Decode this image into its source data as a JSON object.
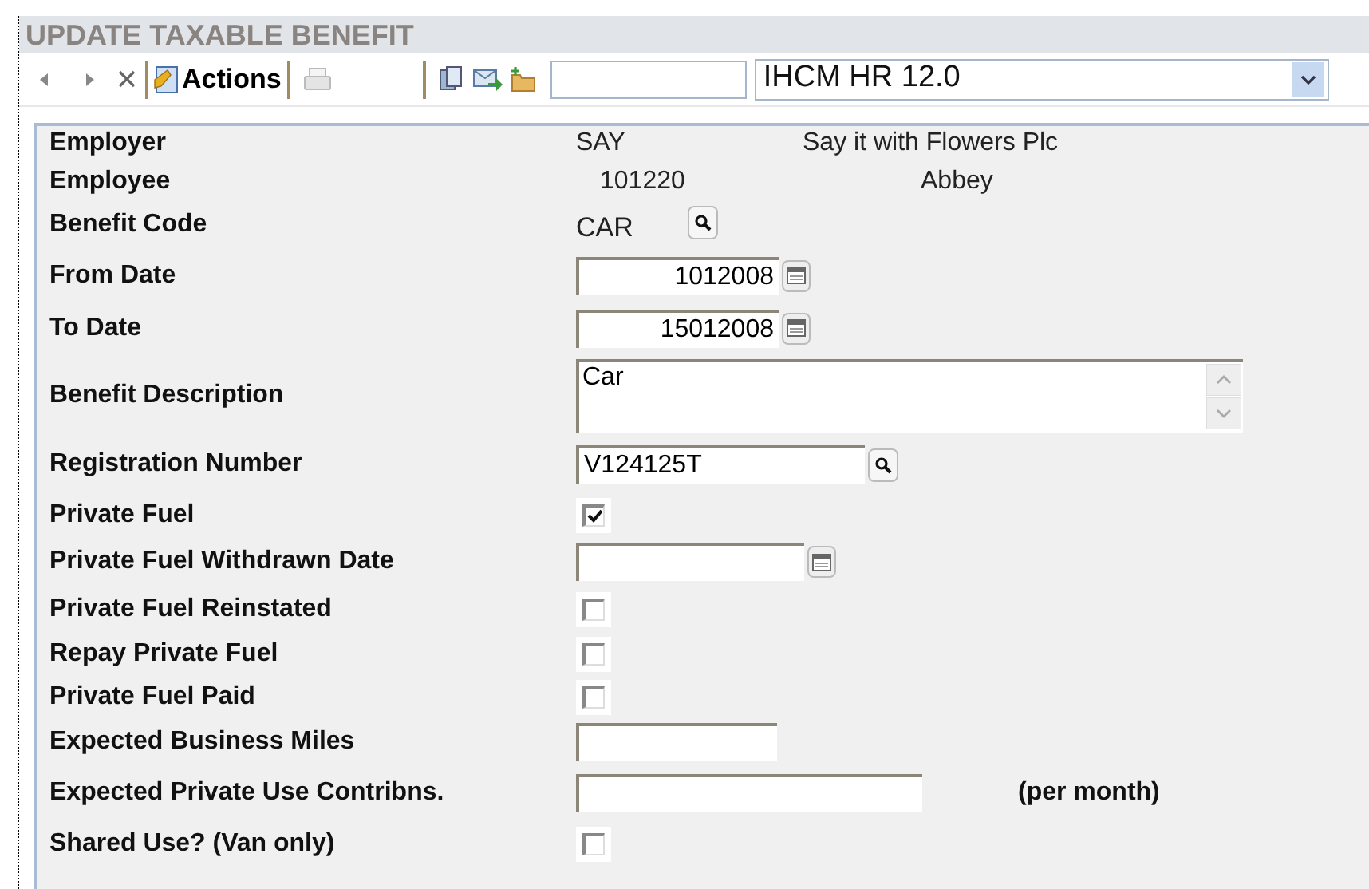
{
  "title": "UPDATE TAXABLE BENEFIT",
  "toolbar": {
    "actions_label": "Actions",
    "system": {
      "value": "IHCM HR 12.0"
    }
  },
  "fields": [
    {
      "kind": "info",
      "label": "Employer",
      "value": "SAY",
      "detail": "Say it with Flowers Plc"
    },
    {
      "kind": "info",
      "label": "Employee",
      "value": "101220",
      "detail": "Abbey"
    },
    {
      "kind": "code",
      "label": "Benefit Code",
      "value": "CAR"
    },
    {
      "kind": "date",
      "label": "From Date",
      "value": "1012008"
    },
    {
      "kind": "date",
      "label": "To Date",
      "value": "15012008"
    },
    {
      "kind": "textarea",
      "label": "Benefit Description",
      "value": "Car"
    },
    {
      "kind": "lookup",
      "label": "Registration Number",
      "value": "V124125T"
    },
    {
      "kind": "checkbox",
      "label": "Private Fuel",
      "checked": true
    },
    {
      "kind": "date",
      "label": "Private Fuel Withdrawn Date"
    },
    {
      "kind": "checkbox",
      "label": "Private Fuel Reinstated",
      "checked": false
    },
    {
      "kind": "checkbox",
      "label": "Repay Private Fuel",
      "checked": false
    },
    {
      "kind": "checkbox",
      "label": "Private Fuel Paid",
      "checked": false
    },
    {
      "kind": "input",
      "label": "Expected Business Miles"
    },
    {
      "kind": "input",
      "label": "Expected Private Use Contribns.",
      "suffix": "(per month)"
    },
    {
      "kind": "checkbox",
      "label": "Shared Use? (Van only)",
      "checked": false
    }
  ]
}
